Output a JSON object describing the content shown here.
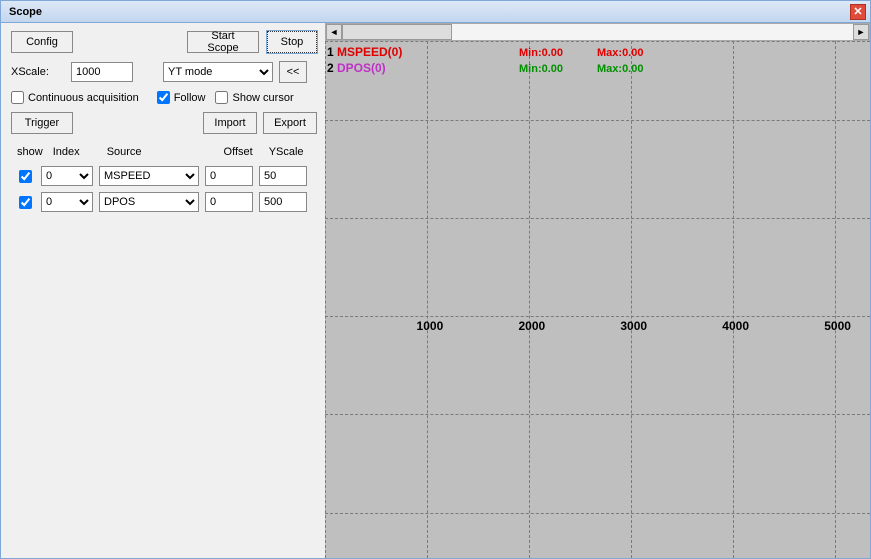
{
  "window": {
    "title": "Scope"
  },
  "toolbar": {
    "config": "Config",
    "start_scope": "Start Scope",
    "stop": "Stop"
  },
  "xscale_label": "XScale:",
  "xscale_value": "1000",
  "mode_value": "YT mode",
  "collapse_label": "<<",
  "checks": {
    "continuous": "Continuous acquisition",
    "continuous_checked": false,
    "follow": "Follow",
    "follow_checked": true,
    "show_cursor": "Show cursor",
    "show_cursor_checked": false
  },
  "trigger": "Trigger",
  "import": "Import",
  "export": "Export",
  "channels_header": {
    "show": "show",
    "index": "Index",
    "source": "Source",
    "offset": "Offset",
    "yscale": "YScale"
  },
  "channels": [
    {
      "show": true,
      "index": "0",
      "source": "MSPEED",
      "offset": "0",
      "yscale": "50"
    },
    {
      "show": true,
      "index": "0",
      "source": "DPOS",
      "offset": "0",
      "yscale": "500"
    }
  ],
  "plot": {
    "traces": [
      {
        "num": "1",
        "name": "MSPEED(0)",
        "min_label": "Min:",
        "min_val": "0.00",
        "max_label": "Max:",
        "max_val": "0.00",
        "color": "red"
      },
      {
        "num": "2",
        "name": "DPOS(0)",
        "min_label": "Min:",
        "min_val": "0.00",
        "max_label": "Max:",
        "max_val": "0.00",
        "color": "magenta"
      }
    ],
    "xticks": [
      "1000",
      "2000",
      "3000",
      "4000",
      "5000"
    ]
  },
  "scroll": {
    "left": "◄",
    "right": "►"
  },
  "chart_data": {
    "type": "line",
    "series": [
      {
        "name": "MSPEED(0)",
        "values": [],
        "min": 0.0,
        "max": 0.0,
        "color": "#E00000"
      },
      {
        "name": "DPOS(0)",
        "values": [],
        "min": 0.0,
        "max": 0.0,
        "color": "#C030C8"
      }
    ],
    "x": [],
    "xlabel": "",
    "ylabel": "",
    "xlim": [
      0,
      5000
    ],
    "xticks": [
      1000,
      2000,
      3000,
      4000,
      5000
    ],
    "grid": true,
    "mode": "YT"
  }
}
